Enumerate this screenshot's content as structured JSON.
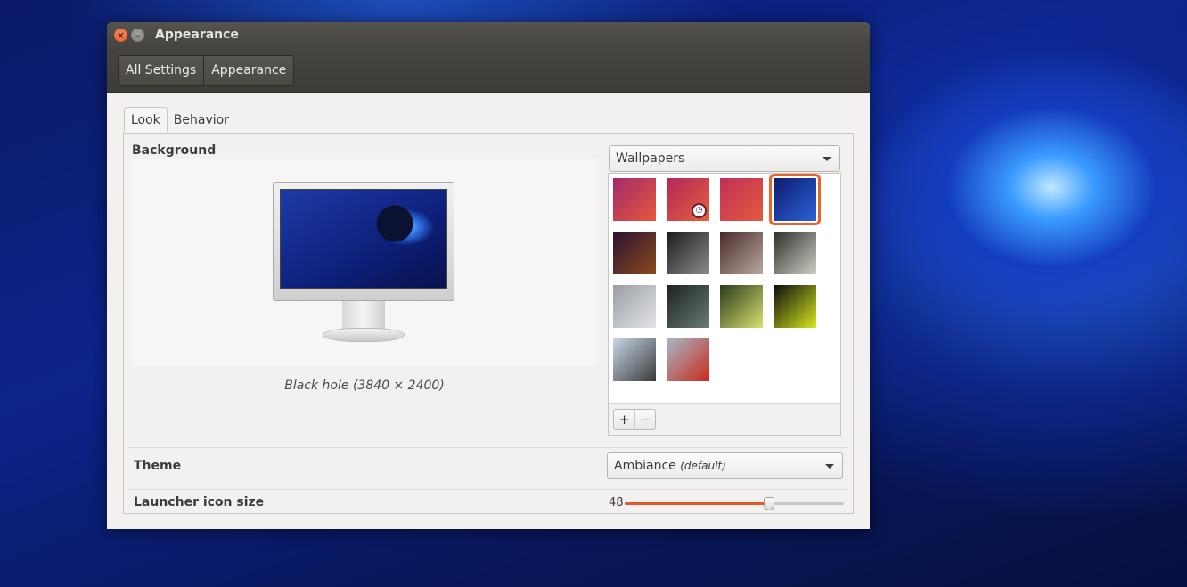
{
  "window": {
    "title": "Appearance",
    "close_symbol": "×",
    "minimize_symbol": "–"
  },
  "breadcrumb": [
    "All Settings",
    "Appearance"
  ],
  "tabs": [
    "Look",
    "Behavior"
  ],
  "active_tab": "Look",
  "background": {
    "label": "Background",
    "source_select": "Wallpapers",
    "preview_caption": "Black hole (3840 × 2400)",
    "selected_wallpaper": "Black hole",
    "thumbnails": [
      {
        "colors": [
          "#a32a6d",
          "#e6573a"
        ]
      },
      {
        "colors": [
          "#b3275a",
          "#e5603c"
        ],
        "badge": "clock-icon"
      },
      {
        "colors": [
          "#c22f58",
          "#e25a3d"
        ]
      },
      {
        "colors": [
          "#0d1a6e",
          "#2a63d6"
        ],
        "selected": true
      },
      {
        "colors": [
          "#2a1230",
          "#8a4a1e"
        ]
      },
      {
        "colors": [
          "#1a1a1a",
          "#8c8c8c"
        ]
      },
      {
        "colors": [
          "#4a2a2a",
          "#b8a7a0"
        ]
      },
      {
        "colors": [
          "#2e2e2a",
          "#cfcfc6"
        ]
      },
      {
        "colors": [
          "#9a9ea3",
          "#e2e4e6"
        ]
      },
      {
        "colors": [
          "#1c2220",
          "#6a7a78"
        ]
      },
      {
        "colors": [
          "#2a3a1a",
          "#d8e070"
        ]
      },
      {
        "colors": [
          "#0a0a0a",
          "#d6e820"
        ]
      },
      {
        "colors": [
          "#c7d6e6",
          "#3a3a3a"
        ]
      },
      {
        "colors": [
          "#a6b8c8",
          "#c82a1a"
        ]
      }
    ],
    "add_label": "+",
    "remove_label": "−"
  },
  "theme": {
    "label": "Theme",
    "value": "Ambiance",
    "hint": "(default)"
  },
  "launcher": {
    "label": "Launcher icon size",
    "value": "48",
    "fraction": 0.66
  },
  "colors": {
    "accent": "#e05a2a",
    "window_bg": "#f2f1f0",
    "titlebar": "#4a4944"
  }
}
